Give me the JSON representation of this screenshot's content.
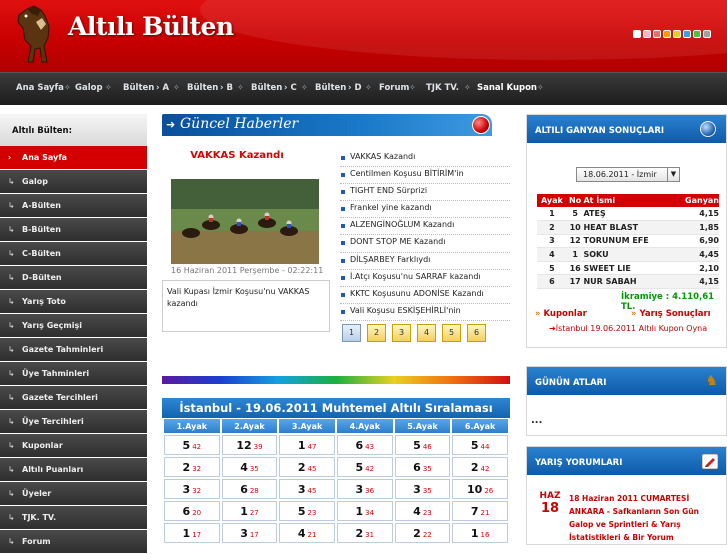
{
  "header": {
    "title": "Altılı Bülten",
    "swatches": [
      "#ffffff",
      "#f4b4c0",
      "#e07070",
      "#ff9a00",
      "#e8d020",
      "#3aa0e0",
      "#50c040",
      "#a0a0a0"
    ]
  },
  "nav": {
    "items": [
      {
        "label": "Ana Sayfa",
        "arrow": ""
      },
      {
        "label": "Galop",
        "arrow": ""
      },
      {
        "label": "Bülten",
        "arrow": "› A"
      },
      {
        "label": "Bülten",
        "arrow": "› B"
      },
      {
        "label": "Bülten",
        "arrow": "› C"
      },
      {
        "label": "Bülten",
        "arrow": "› D"
      },
      {
        "label": "Forum",
        "arrow": ""
      },
      {
        "label": "TJK TV.",
        "arrow": ""
      },
      {
        "label": "Sanal Kupon",
        "arrow": ""
      }
    ],
    "separator": "✧"
  },
  "sidebar": {
    "title": "Altılı Bülten:",
    "items": [
      "Ana Sayfa",
      "Galop",
      "A-Bülten",
      "B-Bülten",
      "C-Bülten",
      "D-Bülten",
      "Yarış Toto",
      "Yarış Geçmişi",
      "Gazete Tahminleri",
      "Üye Tahminleri",
      "Gazete Tercihleri",
      "Üye Tercihleri",
      "Kuponlar",
      "Altılı Puanları",
      "Üyeler",
      "TJK. TV.",
      "Forum"
    ]
  },
  "news": {
    "header": "Güncel Haberler",
    "headline": "VAKKAS Kazandı",
    "photo_caption": "16 Haziran 2011 Perşembe - 02:22:11",
    "summary": "Vali Kupası İzmir Koşusu'nu VAKKAS kazandı",
    "list": [
      "VAKKAS Kazandı",
      "Centilmen Koşusu BİTİRİM'in",
      "TIGHT END Sürprizi",
      "Frankel yine kazandı",
      "ALZENGİNOĞLUM Kazandı",
      "DONT STOP ME Kazandı",
      "DİLŞARBEY Farklıydı",
      "İ.Atçı Koşusu'nu SARRAF kazandı",
      "KKTC Koşusunu ADONİSE Kazandı",
      "Vali Koşusu ESKİŞEHİRLİ'nin"
    ],
    "pages": [
      "1",
      "2",
      "3",
      "4",
      "5",
      "6"
    ]
  },
  "altili": {
    "title": "İstanbul - 19.06.2011 Muhtemel Altılı Sıralaması",
    "headers": [
      "1.Ayak",
      "2.Ayak",
      "3.Ayak",
      "4.Ayak",
      "5.Ayak",
      "6.Ayak"
    ],
    "rows": [
      [
        [
          "5",
          "42"
        ],
        [
          "12",
          "39"
        ],
        [
          "1",
          "47"
        ],
        [
          "6",
          "43"
        ],
        [
          "5",
          "46"
        ],
        [
          "5",
          "44"
        ]
      ],
      [
        [
          "2",
          "32"
        ],
        [
          "4",
          "35"
        ],
        [
          "2",
          "45"
        ],
        [
          "5",
          "42"
        ],
        [
          "6",
          "35"
        ],
        [
          "2",
          "42"
        ]
      ],
      [
        [
          "3",
          "32"
        ],
        [
          "6",
          "28"
        ],
        [
          "3",
          "45"
        ],
        [
          "3",
          "36"
        ],
        [
          "3",
          "35"
        ],
        [
          "10",
          "26"
        ]
      ],
      [
        [
          "6",
          "20"
        ],
        [
          "1",
          "27"
        ],
        [
          "5",
          "23"
        ],
        [
          "1",
          "34"
        ],
        [
          "4",
          "23"
        ],
        [
          "7",
          "21"
        ]
      ],
      [
        [
          "1",
          "17"
        ],
        [
          "3",
          "17"
        ],
        [
          "4",
          "21"
        ],
        [
          "2",
          "31"
        ],
        [
          "2",
          "22"
        ],
        [
          "1",
          "16"
        ]
      ]
    ]
  },
  "results": {
    "header": "ALTILI GANYAN SONUÇLARI",
    "select_value": "18.06.2011 - İzmir",
    "columns": [
      "Ayak",
      "No",
      "At İsmi",
      "Ganyan"
    ],
    "rows": [
      [
        "1",
        "5",
        "ATEŞ",
        "4,15"
      ],
      [
        "2",
        "10",
        "HEAT BLAST",
        "1,85"
      ],
      [
        "3",
        "12",
        "TORUNUM EFE",
        "6,90"
      ],
      [
        "4",
        "1",
        "SOKU",
        "4,45"
      ],
      [
        "5",
        "16",
        "SWEET LIE",
        "2,10"
      ],
      [
        "6",
        "17",
        "NUR SABAH",
        "4,15"
      ]
    ],
    "ikramiye": "İkramiye : 4.110,61 TL.",
    "link_kuponlar": "Kuponlar",
    "link_sonuclar": "Yarış Sonuçları",
    "link_oyna": "İstanbul 19.06.2011  Altılı Kupon Oyna"
  },
  "gunun": {
    "header": "GÜNÜN ATLARI",
    "content": "..."
  },
  "yorum": {
    "header": "YARIŞ YORUMLARI",
    "month": "HAZ",
    "day": "18",
    "text": "18 Haziran 2011 CUMARTESİ ANKARA - Safkanların Son Gün Galop ve Sprintleri & Yarış İstatistikleri & Bir Yorum"
  }
}
